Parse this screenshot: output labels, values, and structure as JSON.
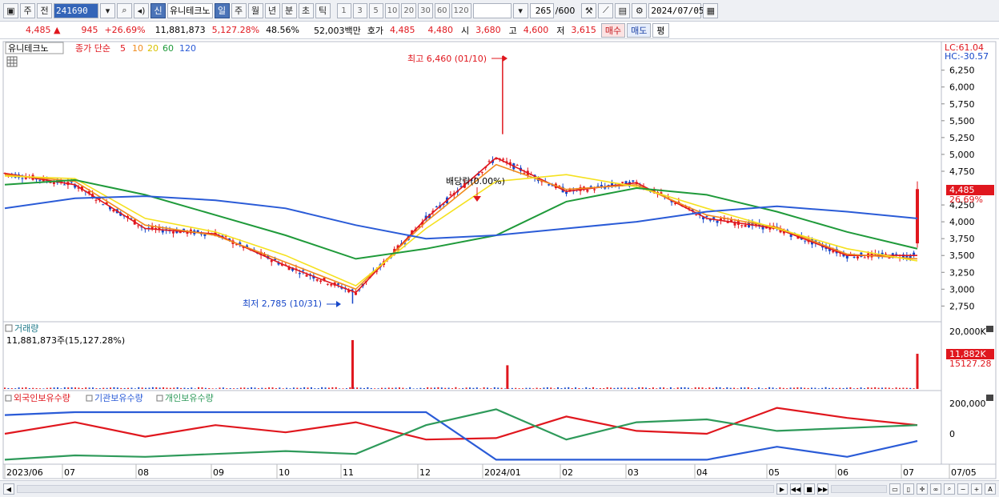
{
  "toolbar": {
    "menu_icon": "window-icon",
    "market_type": "주",
    "prev": "전",
    "code": "241690",
    "new_label": "신",
    "stock_name": "유니테크노",
    "periods": [
      "일",
      "주",
      "월",
      "년",
      "분",
      "초",
      "틱"
    ],
    "active_period": "일",
    "intervals": [
      "1",
      "3",
      "5",
      "10",
      "20",
      "30",
      "60",
      "120"
    ],
    "count": "265",
    "count_total": "/600",
    "date": "2024/07/05"
  },
  "quote": {
    "price": "4,485",
    "change": "945",
    "change_pct": "+26.69%",
    "volume": "11,881,873",
    "volume_pct": "5,127.28%",
    "turnover": "48.56%",
    "amount": "52,003백만",
    "bid_label": "호가",
    "bid1": "4,485",
    "bid2": "4,480",
    "open_label": "시",
    "open": "3,680",
    "high_label": "고",
    "high": "4,600",
    "low_label": "저",
    "low": "3,615",
    "buy_label": "매수",
    "sell_label": "매도",
    "eval_label": "평"
  },
  "price_panel": {
    "name": "유니테크노",
    "ma_label": "종가 단순",
    "ma_periods": [
      "5",
      "10",
      "20",
      "60",
      "120"
    ],
    "lc": "LC:61.04",
    "hc": "HC:-30.57",
    "y_labels": [
      "6,250",
      "6,000",
      "5,750",
      "5,500",
      "5,250",
      "5,000",
      "4,750",
      "4,250",
      "4,000",
      "3,750",
      "3,500",
      "3,250",
      "3,000",
      "2,750"
    ],
    "y_values": [
      6250,
      6000,
      5750,
      5500,
      5250,
      5000,
      4750,
      4250,
      4000,
      3750,
      3500,
      3250,
      3000,
      2750
    ],
    "current_price_tag": "4,485",
    "current_pct_tag": "26.69%",
    "high_annot": "최고 6,460 (01/10)",
    "low_annot": "최저 2,785 (10/31)",
    "div_annot": "배당락(0.00%)"
  },
  "volume_panel": {
    "title": "거래량",
    "value": "11,881,873주(15,127.28%)",
    "scale_top": "20,000K",
    "tag_value": "11,882K",
    "tag_pct": "15127.28"
  },
  "holdings_panel": {
    "legend": [
      "외국인보유수량",
      "기관보유수량",
      "개인보유수량"
    ],
    "scale_top": "200,000",
    "scale_zero": "0"
  },
  "x_labels": [
    "2023/06",
    "07",
    "08",
    "09",
    "10",
    "11",
    "12",
    "2024/01",
    "02",
    "03",
    "04",
    "05",
    "06",
    "07",
    "07/05"
  ],
  "colors": {
    "up": "#e0171e",
    "down": "#1747c9",
    "ma5": "#e0171e",
    "ma10": "#f08c1e",
    "ma20": "#f5e11e",
    "ma60": "#1f9a3a",
    "ma120": "#2a5bd7",
    "foreign": "#e0171e",
    "inst": "#2a5bd7",
    "retail": "#2e9a5a"
  },
  "chart_data": [
    {
      "type": "line",
      "panel": "price",
      "title": "유니테크노",
      "ylim": [
        2600,
        6460
      ],
      "x": [
        "2023/06",
        "07",
        "08",
        "09",
        "10",
        "11",
        "12",
        "2024/01",
        "02",
        "03",
        "04",
        "05",
        "06",
        "07"
      ],
      "series": [
        {
          "name": "5",
          "values": [
            4720,
            4550,
            3900,
            3820,
            3350,
            2950,
            4050,
            4950,
            4450,
            4580,
            4050,
            3900,
            3500,
            3500
          ]
        },
        {
          "name": "10",
          "values": [
            4700,
            4600,
            3950,
            3800,
            3400,
            3000,
            4000,
            4850,
            4480,
            4550,
            4100,
            3920,
            3520,
            3450
          ]
        },
        {
          "name": "20",
          "values": [
            4680,
            4640,
            4050,
            3850,
            3500,
            3050,
            3900,
            4600,
            4700,
            4520,
            4200,
            3900,
            3600,
            3420
          ]
        },
        {
          "name": "60",
          "values": [
            4550,
            4620,
            4400,
            4100,
            3800,
            3450,
            3600,
            3800,
            4300,
            4500,
            4400,
            4150,
            3850,
            3600
          ]
        },
        {
          "name": "120",
          "values": [
            4200,
            4350,
            4380,
            4320,
            4200,
            3950,
            3750,
            3800,
            3900,
            4000,
            4150,
            4230,
            4150,
            4050
          ]
        }
      ],
      "highlights": {
        "max": 6460,
        "min": 2785,
        "last": 4485
      }
    },
    {
      "type": "bar",
      "panel": "volume",
      "title": "거래량",
      "ylim": [
        0,
        20000
      ],
      "spikes_k": [
        {
          "x": "11",
          "value": 16500
        },
        {
          "x": "2024/01",
          "value": 8000
        },
        {
          "x": "07",
          "value": 11882
        }
      ]
    },
    {
      "type": "line",
      "panel": "holdings",
      "ylim": [
        -200000,
        200000
      ],
      "series": [
        {
          "name": "외국인보유수량",
          "values": [
            0,
            80000,
            -20000,
            60000,
            10000,
            80000,
            -40000,
            -30000,
            120000,
            20000,
            0,
            180000,
            110000,
            60000
          ]
        },
        {
          "name": "기관보유수량",
          "values": [
            130000,
            150000,
            150000,
            150000,
            150000,
            150000,
            150000,
            -180000,
            -180000,
            -180000,
            -180000,
            -90000,
            -160000,
            -50000
          ]
        },
        {
          "name": "개인보유수량",
          "values": [
            -180000,
            -150000,
            -160000,
            -140000,
            -120000,
            -140000,
            60000,
            170000,
            -40000,
            80000,
            100000,
            20000,
            40000,
            60000
          ]
        }
      ]
    }
  ]
}
